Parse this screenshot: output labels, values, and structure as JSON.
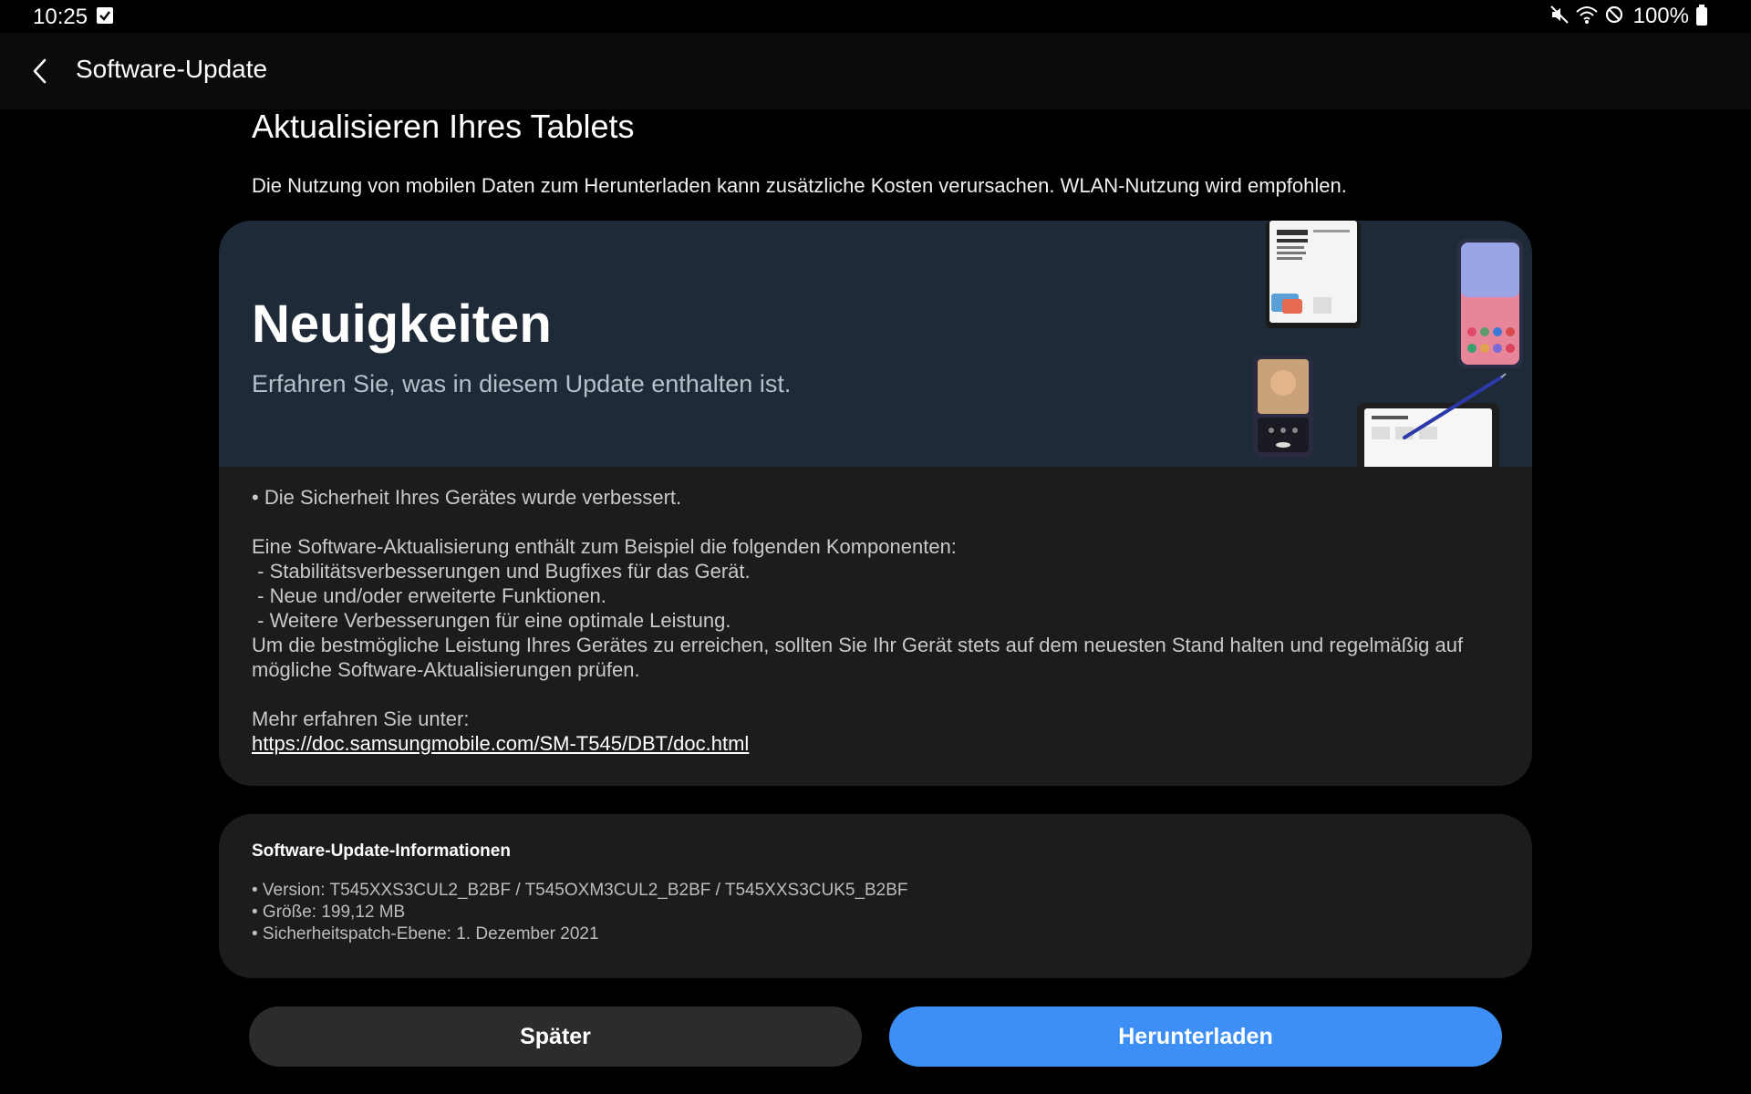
{
  "status_bar": {
    "time": "10:25",
    "battery_percent": "100%",
    "icons": [
      "checkbox-notification-icon",
      "mute-icon",
      "wifi-icon",
      "do-not-disturb-icon",
      "battery-icon"
    ]
  },
  "app_bar": {
    "title": "Software-Update",
    "back_icon": "chevron-left-icon"
  },
  "page": {
    "heading": "Aktualisieren Ihres Tablets",
    "notice": "Die Nutzung von mobilen Daten zum Herunterladen kann zusätzliche Kosten verursachen. WLAN-Nutzung wird empfohlen."
  },
  "whats_new": {
    "title": "Neuigkeiten",
    "subtitle": "Erfahren Sie, was in diesem Update enthalten ist.",
    "banner_color": "#1f2a38",
    "notes": {
      "security": "• Die Sicherheit Ihres Gerätes wurde verbessert.",
      "intro": "Eine Software-Aktualisierung enthält zum Beispiel die folgenden Komponenten:",
      "item1": " - Stabilitätsverbesserungen und Bugfixes für das Gerät.",
      "item2": " - Neue und/oder erweiterte Funktionen.",
      "item3": " - Weitere Verbesserungen für eine optimale Leistung.",
      "recommendation": "Um die bestmögliche Leistung Ihres Gerätes zu erreichen, sollten Sie Ihr Gerät stets auf dem neuesten Stand halten und regelmäßig auf mögliche Software-Aktualisierungen prüfen.",
      "more_label": "Mehr erfahren Sie unter:",
      "more_link": "https://doc.samsungmobile.com/SM-T545/DBT/doc.html"
    }
  },
  "update_info": {
    "title": "Software-Update-Informationen",
    "version": "• Version: T545XXS3CUL2_B2BF / T545OXM3CUL2_B2BF / T545XXS3CUK5_B2BF",
    "size": "• Größe: 199,12 MB",
    "security_patch": "• Sicherheitspatch-Ebene: 1. Dezember 2021"
  },
  "buttons": {
    "later": "Später",
    "download": "Herunterladen",
    "download_color": "#3d8ef5"
  }
}
